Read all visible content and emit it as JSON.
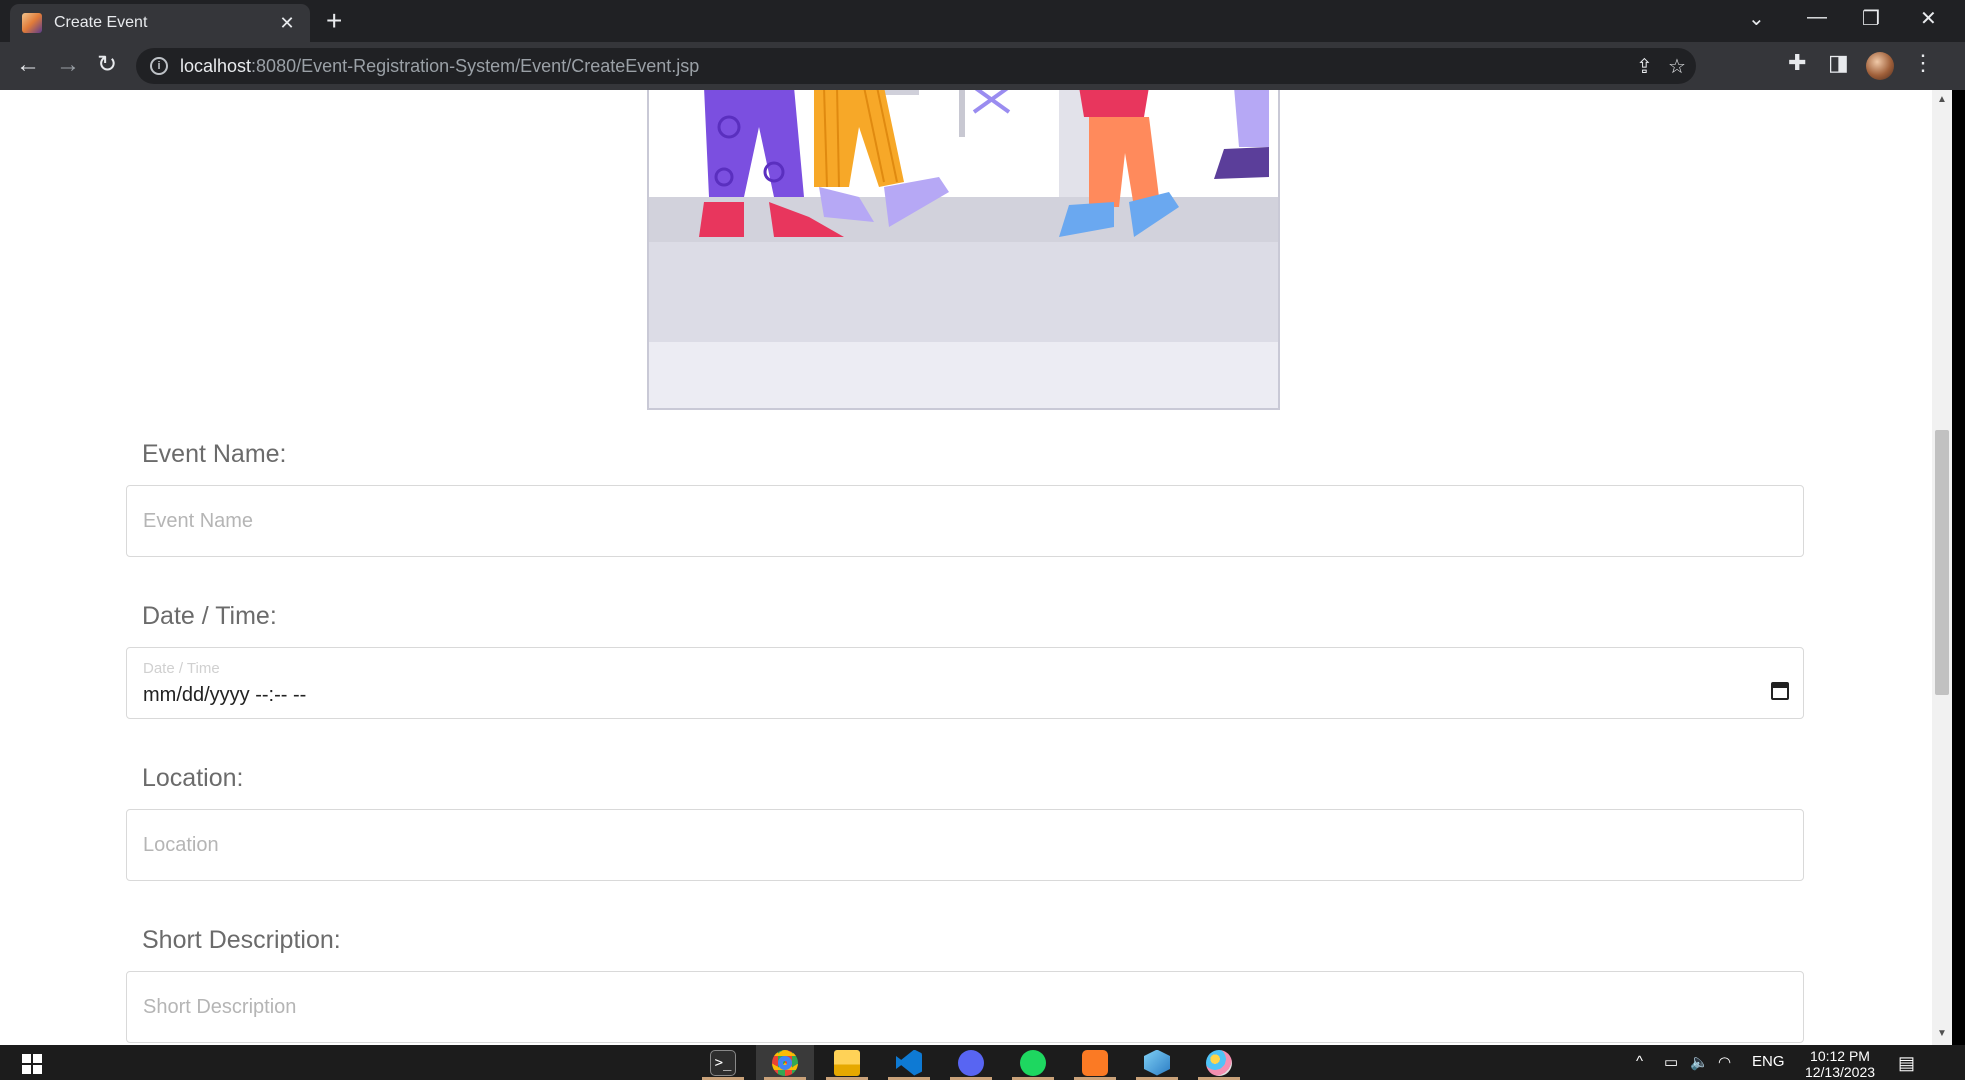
{
  "browser": {
    "tab_title": "Create Event",
    "url_host": "localhost",
    "url_rest": ":8080/Event-Registration-System/Event/CreateEvent.jsp"
  },
  "form": {
    "event_name": {
      "label": "Event Name:",
      "placeholder": "Event Name"
    },
    "date_time": {
      "label": "Date / Time:",
      "placeholder": "Date / Time",
      "value": "mm/dd/yyyy --:-- --"
    },
    "location": {
      "label": "Location:",
      "placeholder": "Location"
    },
    "short_description": {
      "label": "Short Description:",
      "placeholder": "Short Description"
    }
  },
  "taskbar": {
    "apps": [
      "terminal-icon",
      "chrome-icon",
      "file-explorer-icon",
      "vscode-icon",
      "discord-icon",
      "spotify-icon",
      "xampp-icon",
      "virtualbox-icon",
      "paint-icon"
    ],
    "language": "ENG",
    "time": "10:12 PM",
    "date": "12/13/2023"
  },
  "colors": {
    "chrome_dark": "#202124",
    "chrome_toolbar": "#35363a",
    "label_text": "#6b6b6b",
    "field_border": "#d9d9d9"
  }
}
